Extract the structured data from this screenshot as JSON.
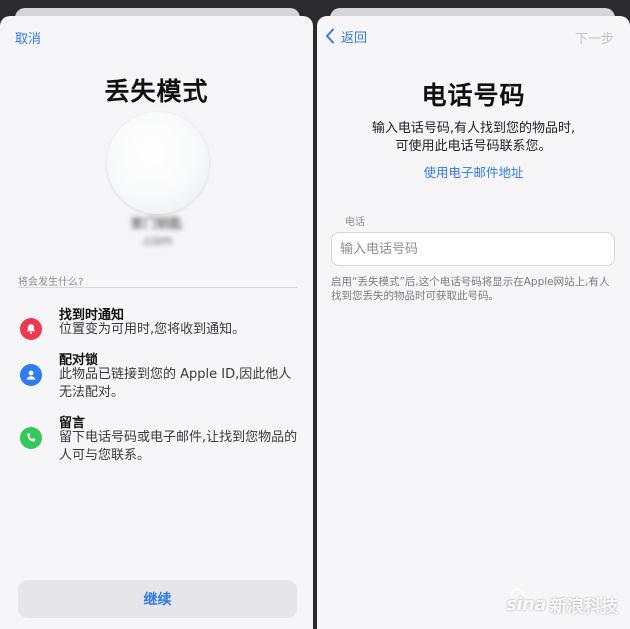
{
  "left": {
    "cancel_label": "取消",
    "title": "丢失模式",
    "item_name": "家门钥匙",
    "email_obscured": ".com",
    "section_label": "将会发生什么?",
    "features": [
      {
        "icon": "bell-icon",
        "color": "#f2374f",
        "title": "找到时通知",
        "text": "位置变为可用时,您将收到通知。"
      },
      {
        "icon": "person-icon",
        "color": "#2f7bf5",
        "title": "配对锁",
        "text": "此物品已链接到您的 Apple ID,因此他人无法配对。"
      },
      {
        "icon": "phone-icon",
        "color": "#34c759",
        "title": "留言",
        "text": "留下电话号码或电子邮件,让找到您物品的人可与您联系。"
      }
    ],
    "continue_label": "继续"
  },
  "right": {
    "back_label": "返回",
    "next_label": "下一步",
    "title": "电话号码",
    "description_line1": "输入电话号码,有人找到您的物品时,",
    "description_line2": "可使用此电话号码联系您。",
    "email_link": "使用电子邮件地址",
    "field_label": "电话",
    "input_placeholder": "输入电话号码",
    "input_value": "",
    "footnote": "启用“丢失模式”后,这个电话号码将显示在Apple网站上,有人找到您丢失的物品时可获取此号码。"
  },
  "watermark": {
    "brand": "sina",
    "text": "新浪科技"
  },
  "colors": {
    "accent": "#2f7bf5",
    "red": "#f2374f",
    "green": "#34c759",
    "sheet": "#f6f6f8"
  }
}
